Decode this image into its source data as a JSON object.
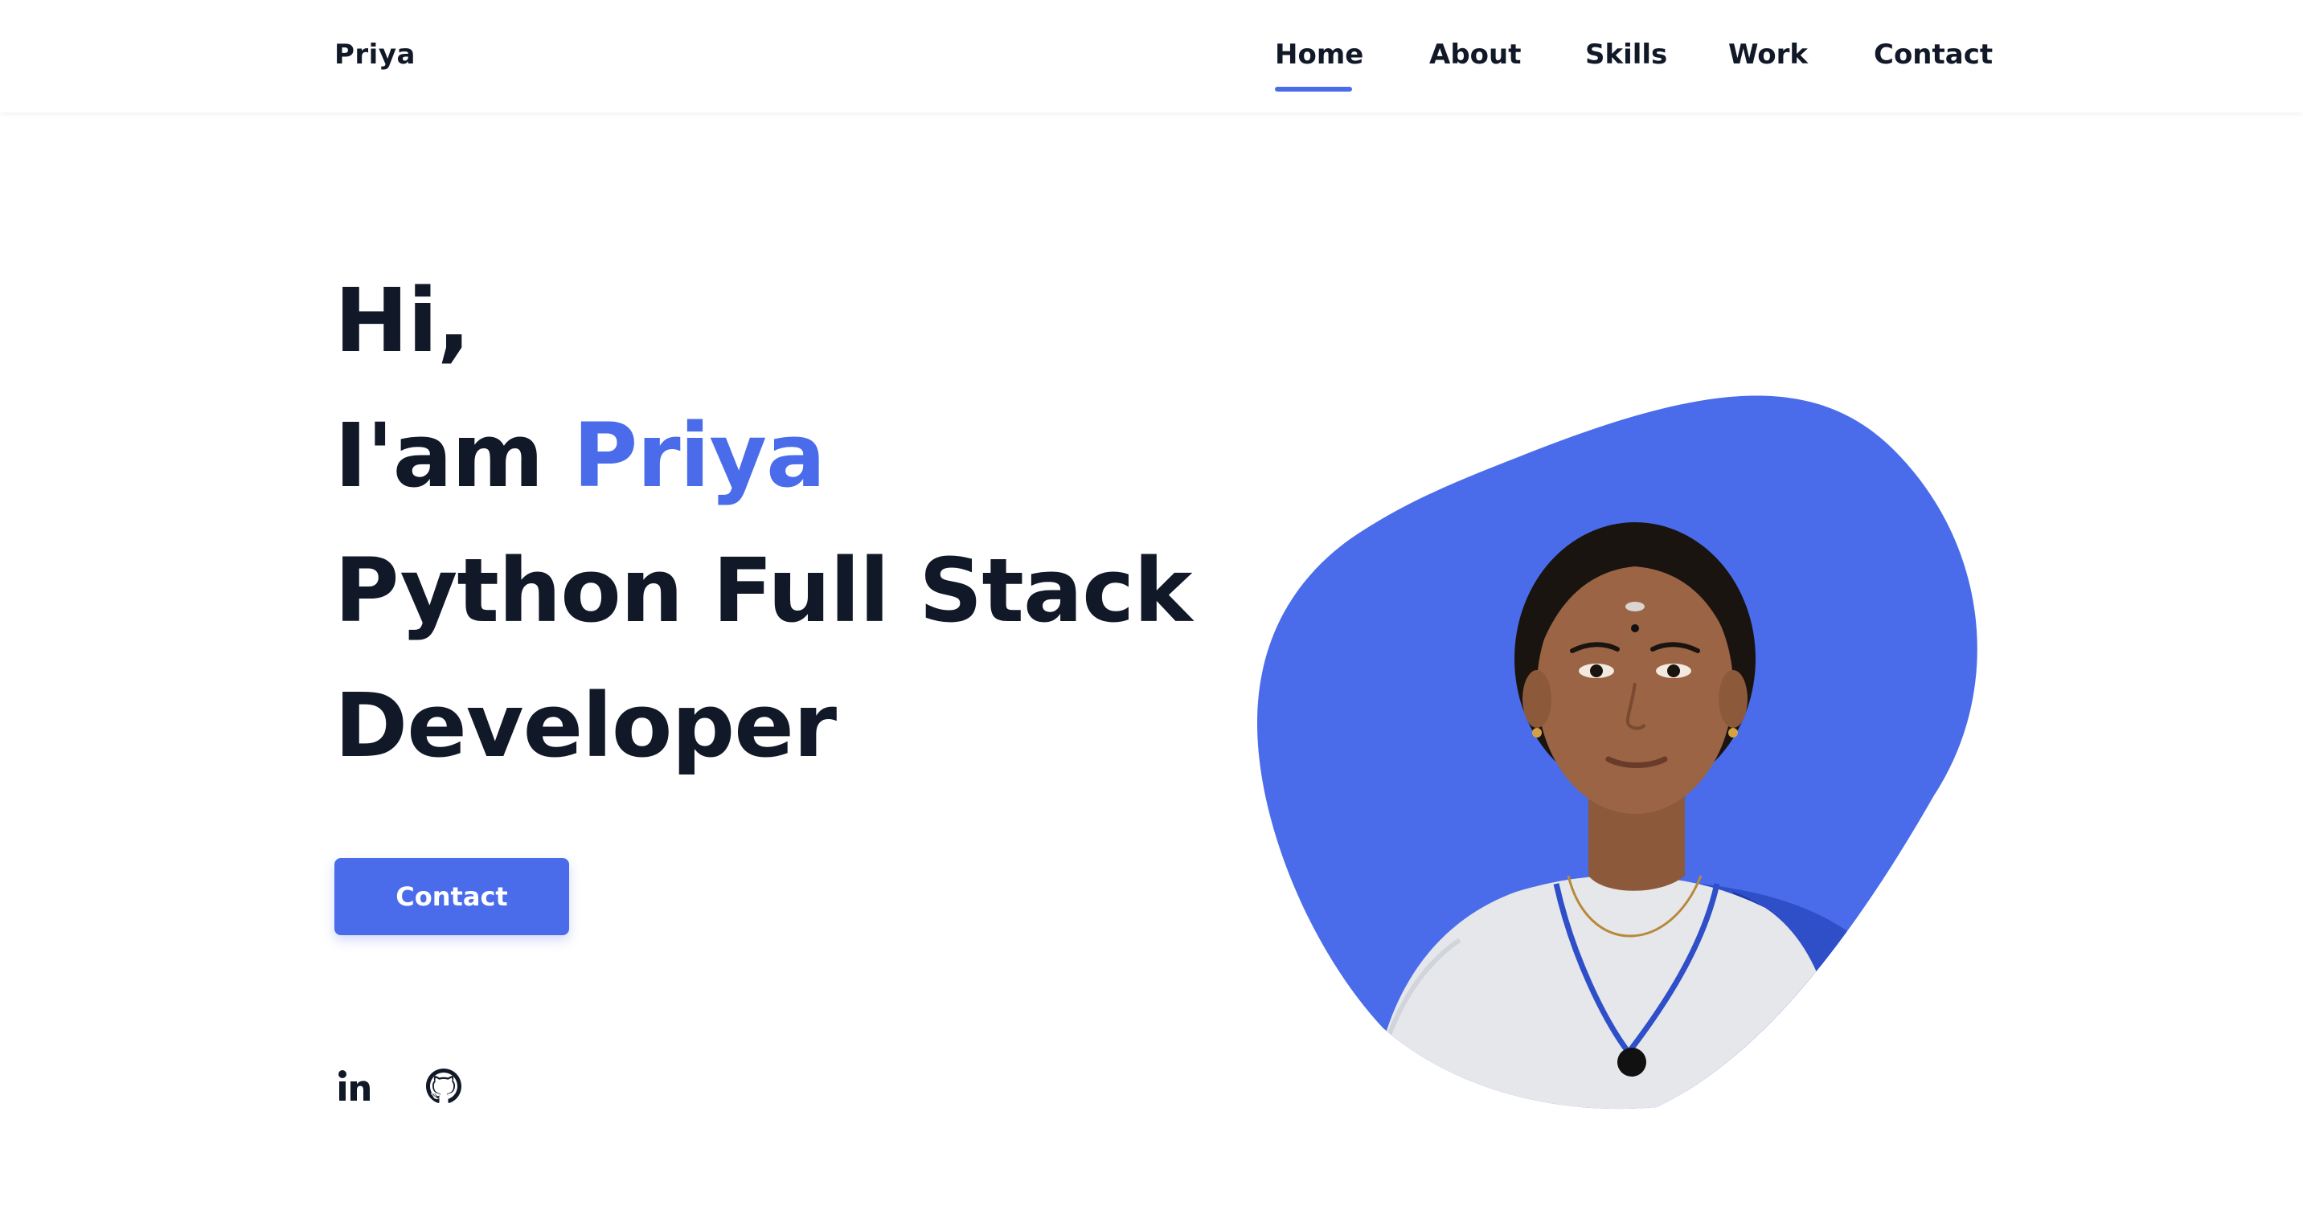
{
  "header": {
    "logo": "Priya",
    "nav": {
      "home": "Home",
      "about": "About",
      "skills": "Skills",
      "work": "Work",
      "contact": "Contact"
    },
    "active_nav": "Home"
  },
  "hero": {
    "greeting": "Hi,",
    "intro_prefix": "I'am ",
    "name": "Priya",
    "title_line1": "Python Full Stack",
    "title_line2": "Developer",
    "button_label": "Contact"
  },
  "social": {
    "icons": [
      "linkedin-icon",
      "github-icon"
    ]
  },
  "colors": {
    "accent": "#4a6cea",
    "text": "#111827",
    "background": "#ffffff"
  }
}
